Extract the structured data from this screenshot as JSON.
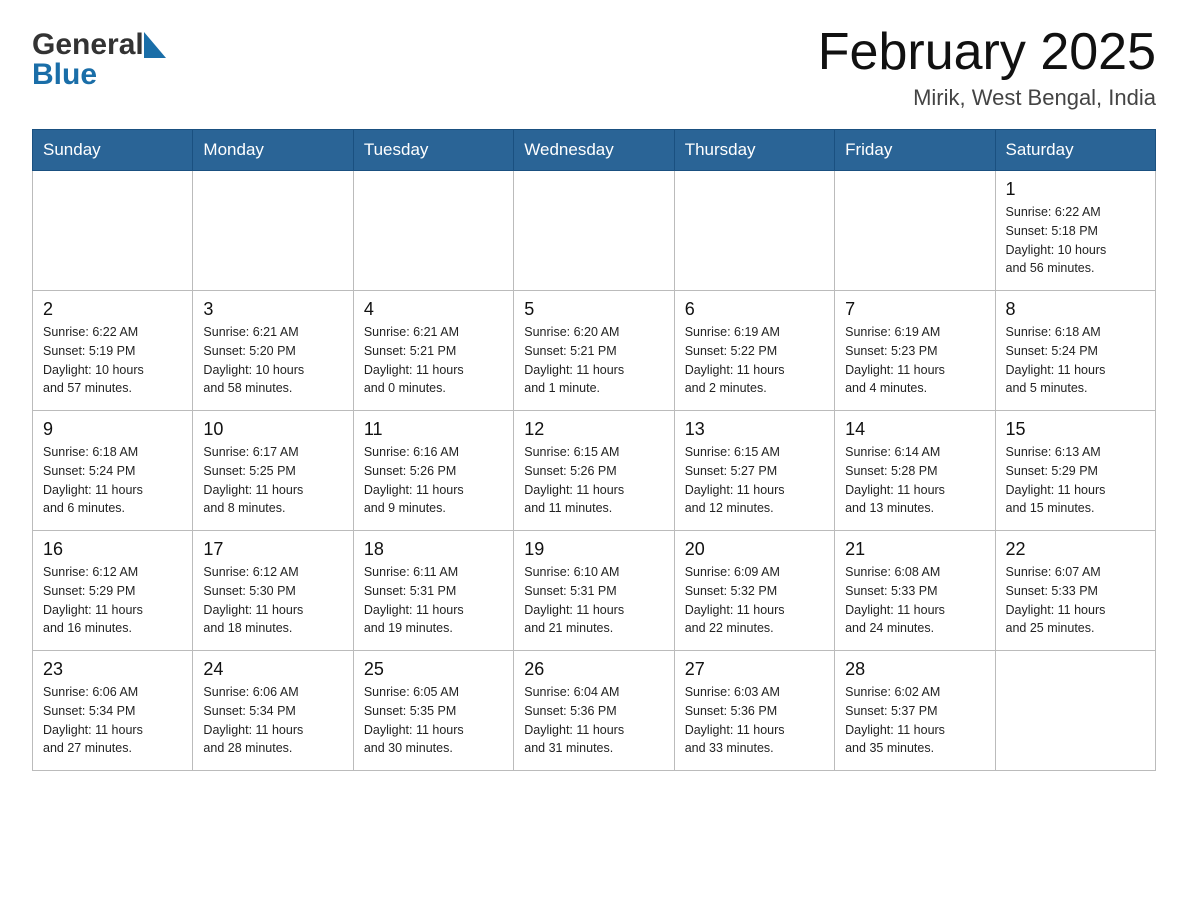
{
  "header": {
    "logo_general": "General",
    "logo_blue": "Blue",
    "title": "February 2025",
    "subtitle": "Mirik, West Bengal, India"
  },
  "days_of_week": [
    "Sunday",
    "Monday",
    "Tuesday",
    "Wednesday",
    "Thursday",
    "Friday",
    "Saturday"
  ],
  "weeks": [
    [
      {
        "day": "",
        "info": ""
      },
      {
        "day": "",
        "info": ""
      },
      {
        "day": "",
        "info": ""
      },
      {
        "day": "",
        "info": ""
      },
      {
        "day": "",
        "info": ""
      },
      {
        "day": "",
        "info": ""
      },
      {
        "day": "1",
        "info": "Sunrise: 6:22 AM\nSunset: 5:18 PM\nDaylight: 10 hours\nand 56 minutes."
      }
    ],
    [
      {
        "day": "2",
        "info": "Sunrise: 6:22 AM\nSunset: 5:19 PM\nDaylight: 10 hours\nand 57 minutes."
      },
      {
        "day": "3",
        "info": "Sunrise: 6:21 AM\nSunset: 5:20 PM\nDaylight: 10 hours\nand 58 minutes."
      },
      {
        "day": "4",
        "info": "Sunrise: 6:21 AM\nSunset: 5:21 PM\nDaylight: 11 hours\nand 0 minutes."
      },
      {
        "day": "5",
        "info": "Sunrise: 6:20 AM\nSunset: 5:21 PM\nDaylight: 11 hours\nand 1 minute."
      },
      {
        "day": "6",
        "info": "Sunrise: 6:19 AM\nSunset: 5:22 PM\nDaylight: 11 hours\nand 2 minutes."
      },
      {
        "day": "7",
        "info": "Sunrise: 6:19 AM\nSunset: 5:23 PM\nDaylight: 11 hours\nand 4 minutes."
      },
      {
        "day": "8",
        "info": "Sunrise: 6:18 AM\nSunset: 5:24 PM\nDaylight: 11 hours\nand 5 minutes."
      }
    ],
    [
      {
        "day": "9",
        "info": "Sunrise: 6:18 AM\nSunset: 5:24 PM\nDaylight: 11 hours\nand 6 minutes."
      },
      {
        "day": "10",
        "info": "Sunrise: 6:17 AM\nSunset: 5:25 PM\nDaylight: 11 hours\nand 8 minutes."
      },
      {
        "day": "11",
        "info": "Sunrise: 6:16 AM\nSunset: 5:26 PM\nDaylight: 11 hours\nand 9 minutes."
      },
      {
        "day": "12",
        "info": "Sunrise: 6:15 AM\nSunset: 5:26 PM\nDaylight: 11 hours\nand 11 minutes."
      },
      {
        "day": "13",
        "info": "Sunrise: 6:15 AM\nSunset: 5:27 PM\nDaylight: 11 hours\nand 12 minutes."
      },
      {
        "day": "14",
        "info": "Sunrise: 6:14 AM\nSunset: 5:28 PM\nDaylight: 11 hours\nand 13 minutes."
      },
      {
        "day": "15",
        "info": "Sunrise: 6:13 AM\nSunset: 5:29 PM\nDaylight: 11 hours\nand 15 minutes."
      }
    ],
    [
      {
        "day": "16",
        "info": "Sunrise: 6:12 AM\nSunset: 5:29 PM\nDaylight: 11 hours\nand 16 minutes."
      },
      {
        "day": "17",
        "info": "Sunrise: 6:12 AM\nSunset: 5:30 PM\nDaylight: 11 hours\nand 18 minutes."
      },
      {
        "day": "18",
        "info": "Sunrise: 6:11 AM\nSunset: 5:31 PM\nDaylight: 11 hours\nand 19 minutes."
      },
      {
        "day": "19",
        "info": "Sunrise: 6:10 AM\nSunset: 5:31 PM\nDaylight: 11 hours\nand 21 minutes."
      },
      {
        "day": "20",
        "info": "Sunrise: 6:09 AM\nSunset: 5:32 PM\nDaylight: 11 hours\nand 22 minutes."
      },
      {
        "day": "21",
        "info": "Sunrise: 6:08 AM\nSunset: 5:33 PM\nDaylight: 11 hours\nand 24 minutes."
      },
      {
        "day": "22",
        "info": "Sunrise: 6:07 AM\nSunset: 5:33 PM\nDaylight: 11 hours\nand 25 minutes."
      }
    ],
    [
      {
        "day": "23",
        "info": "Sunrise: 6:06 AM\nSunset: 5:34 PM\nDaylight: 11 hours\nand 27 minutes."
      },
      {
        "day": "24",
        "info": "Sunrise: 6:06 AM\nSunset: 5:34 PM\nDaylight: 11 hours\nand 28 minutes."
      },
      {
        "day": "25",
        "info": "Sunrise: 6:05 AM\nSunset: 5:35 PM\nDaylight: 11 hours\nand 30 minutes."
      },
      {
        "day": "26",
        "info": "Sunrise: 6:04 AM\nSunset: 5:36 PM\nDaylight: 11 hours\nand 31 minutes."
      },
      {
        "day": "27",
        "info": "Sunrise: 6:03 AM\nSunset: 5:36 PM\nDaylight: 11 hours\nand 33 minutes."
      },
      {
        "day": "28",
        "info": "Sunrise: 6:02 AM\nSunset: 5:37 PM\nDaylight: 11 hours\nand 35 minutes."
      },
      {
        "day": "",
        "info": ""
      }
    ]
  ]
}
